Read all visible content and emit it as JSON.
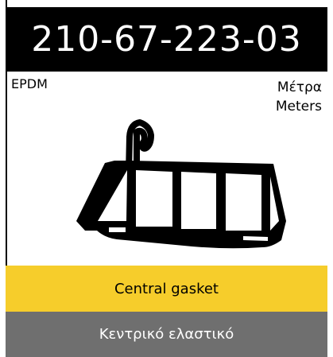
{
  "product": {
    "code": "210-67-223-03",
    "material": "EPDM",
    "unit_gr": "Μέτρα",
    "unit_en": "Meters"
  },
  "labels": {
    "name_en": "Central gasket",
    "name_gr": "Κεντρικό ελαστικό"
  },
  "colors": {
    "header_bg": "#000000",
    "header_text": "#ffffff",
    "yellow_bar": "#f6cd2b",
    "gray_bar": "#6f6f6f"
  }
}
